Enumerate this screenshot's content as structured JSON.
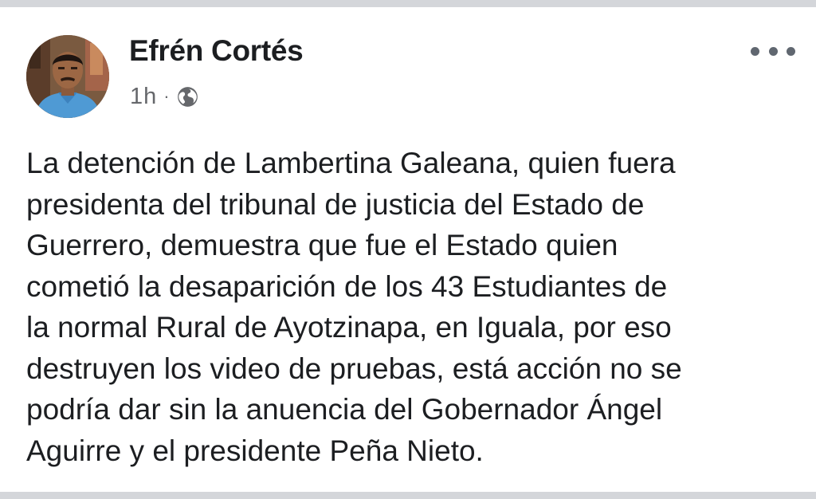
{
  "post": {
    "author": {
      "name": "Efrén Cortés",
      "avatar": "profile-photo"
    },
    "timestamp": "1h",
    "separator": "·",
    "privacy_icon": "globe-icon",
    "more_icon": "more-options-icon",
    "text_lines": [
      "La detención de Lambertina Galeana, quien fuera",
      "presidenta del tribunal de justicia del Estado de",
      "Guerrero, demuestra que fue el Estado quien",
      "cometió la desaparición de los 43 Estudiantes de",
      "la normal Rural de Ayotzinapa, en Iguala, por eso",
      "destruyen los video de pruebas, está acción no se",
      "podría dar sin la anuencia del Gobernador Ángel",
      "Aguirre y el presidente Peña Nieto."
    ]
  },
  "colors": {
    "divider": "#d4d6da",
    "text": "#1c1e21",
    "secondary_text": "#65676b",
    "icon": "#606770"
  }
}
